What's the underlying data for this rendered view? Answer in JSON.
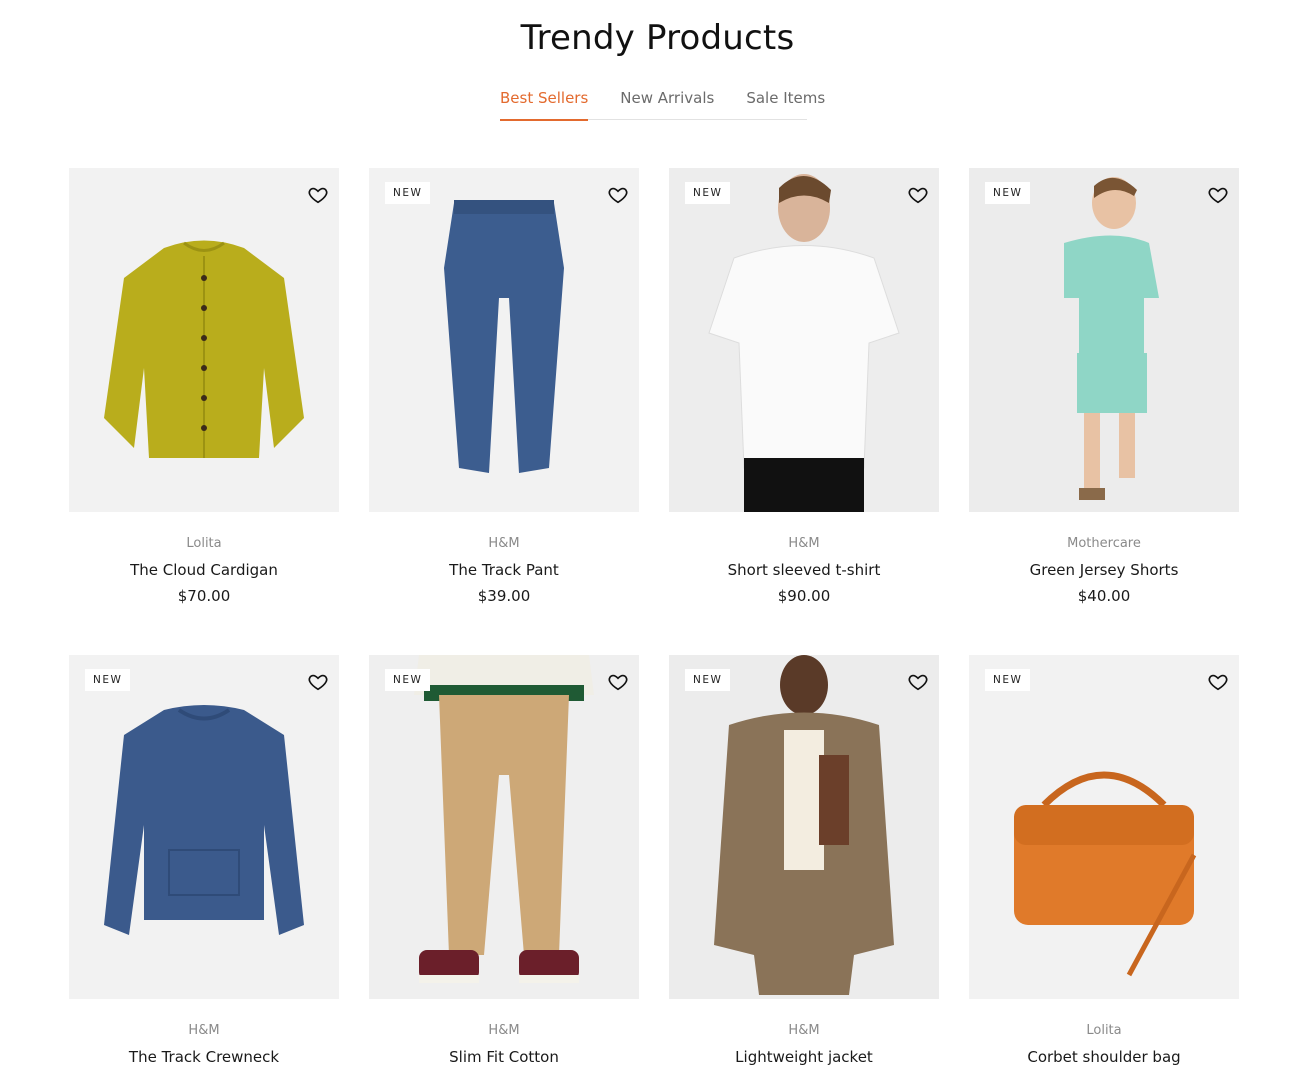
{
  "section": {
    "title": "Trendy Products"
  },
  "tabs": [
    {
      "label": "Best Sellers",
      "active": true
    },
    {
      "label": "New Arrivals",
      "active": false
    },
    {
      "label": "Sale Items",
      "active": false
    }
  ],
  "colors": {
    "accent": "#e36a2e",
    "card_bg": "#f2f2f2"
  },
  "products": [
    {
      "badge": "",
      "brand": "Lolita",
      "name": "The Cloud Cardigan",
      "price": "$70.00",
      "image": "mustard-cardigan"
    },
    {
      "badge": "NEW",
      "brand": "H&M",
      "name": "The Track Pant",
      "price": "$39.00",
      "image": "navy-track-pant"
    },
    {
      "badge": "NEW",
      "brand": "H&M",
      "name": "Short sleeved t-shirt",
      "price": "$90.00",
      "image": "white-tshirt-model"
    },
    {
      "badge": "NEW",
      "brand": "Mothercare",
      "name": "Green Jersey Shorts",
      "price": "$40.00",
      "image": "kid-green-set"
    },
    {
      "badge": "NEW",
      "brand": "H&M",
      "name": "The Track Crewneck",
      "price": "",
      "image": "navy-crewneck"
    },
    {
      "badge": "NEW",
      "brand": "H&M",
      "name": "Slim Fit Cotton",
      "price": "",
      "image": "khaki-chinos"
    },
    {
      "badge": "NEW",
      "brand": "H&M",
      "name": "Lightweight jacket",
      "price": "",
      "image": "fleece-jacket-model"
    },
    {
      "badge": "NEW",
      "brand": "Lolita",
      "name": "Corbet shoulder bag",
      "price": "",
      "image": "orange-bag"
    }
  ],
  "icons": {
    "wishlist": "heart-icon"
  }
}
